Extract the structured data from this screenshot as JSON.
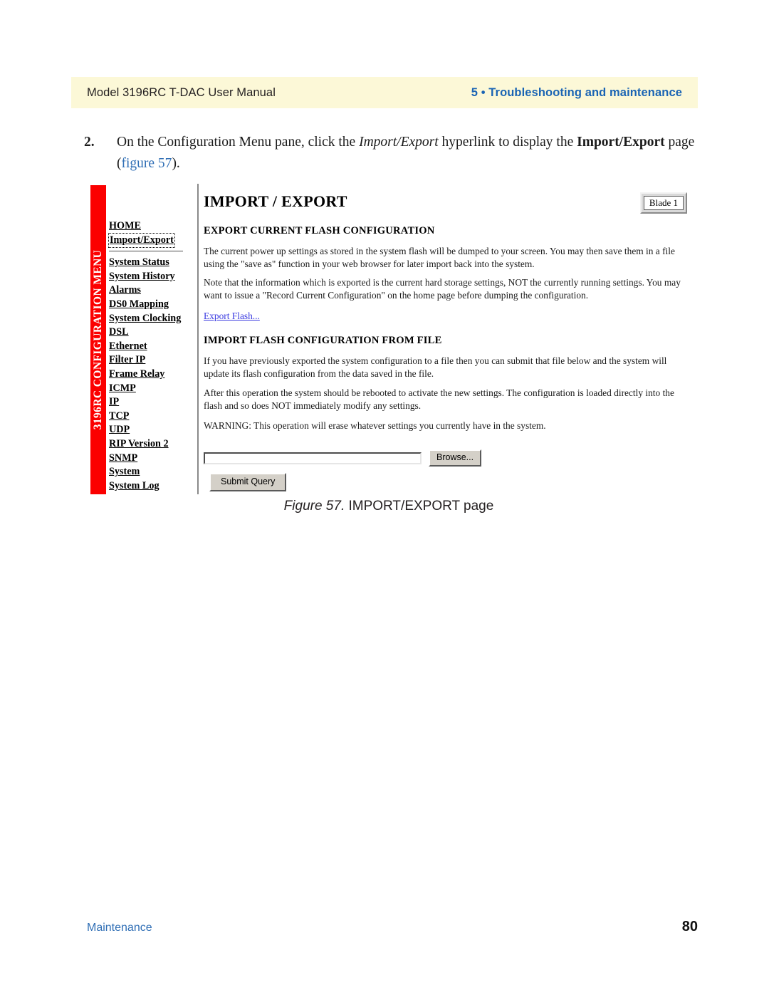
{
  "header": {
    "left_title": "Model 3196RC T-DAC User Manual",
    "right_title": "5 • Troubleshooting and maintenance",
    "band_color": "#fcf8d7",
    "accent_color": "#1a64b4"
  },
  "step": {
    "number": "2.",
    "text_part1": "On the Configuration Menu pane, click the ",
    "emphasis": "Import/Export",
    "text_part2": " hyperlink to display the ",
    "bold_term": "Import/Export",
    "text_part3": " page",
    "xref_open": "(",
    "xref": "figure 57",
    "xref_close": ")."
  },
  "figure": {
    "caption_label": "Figure 57.",
    "caption_text": " IMPORT/EXPORT page",
    "banner": {
      "label": "3196RC CONFIGURATION MENU",
      "color": "#fb0000"
    },
    "nav": {
      "items": [
        {
          "label": "HOME",
          "focused": false
        },
        {
          "label": "Import/Export",
          "focused": true
        },
        {
          "label": "System Status",
          "focused": false
        },
        {
          "label": "System History",
          "focused": false
        },
        {
          "label": "Alarms",
          "focused": false
        },
        {
          "label": "DS0 Mapping",
          "focused": false
        },
        {
          "label": "System Clocking",
          "focused": false
        },
        {
          "label": "DSL",
          "focused": false
        },
        {
          "label": "Ethernet",
          "focused": false
        },
        {
          "label": "Filter IP",
          "focused": false
        },
        {
          "label": "Frame Relay",
          "focused": false
        },
        {
          "label": "ICMP",
          "focused": false
        },
        {
          "label": "IP",
          "focused": false
        },
        {
          "label": "TCP",
          "focused": false
        },
        {
          "label": "UDP",
          "focused": false
        },
        {
          "label": "RIP Version 2",
          "focused": false
        },
        {
          "label": "SNMP",
          "focused": false
        },
        {
          "label": "System",
          "focused": false
        },
        {
          "label": "System Log",
          "focused": false
        }
      ]
    },
    "content": {
      "page_title": "IMPORT / EXPORT",
      "blade_badge": "Blade 1",
      "export_heading": "EXPORT CURRENT FLASH CONFIGURATION",
      "export_para1": "The current power up settings as stored in the system flash will be dumped to your screen.  You may then save them in a file using the \"save as\" function in your web browser for later import back into the system.",
      "export_para2": "Note that the information which is exported is the current hard storage settings, NOT the currently running settings.  You may want to issue a \"Record Current Configuration\" on the home page before dumping the configuration.",
      "export_link": "Export Flash...",
      "import_heading": "IMPORT FLASH CONFIGURATION FROM FILE",
      "import_para1": "If you have previously exported the system configuration to a file then you can submit that file below and the system will update its flash configuration from the data saved in the file.",
      "import_para2": "After this operation the system should be rebooted to activate the new settings. The configuration is loaded directly into the flash and so does NOT immediately modify any settings.",
      "import_warning": "WARNING: This operation will erase whatever settings you currently have in the system.",
      "file_input_value": "",
      "file_input_placeholder": "",
      "browse_button": "Browse...",
      "submit_button": "Submit Query"
    }
  },
  "footer": {
    "section": "Maintenance",
    "page_number": "80"
  }
}
